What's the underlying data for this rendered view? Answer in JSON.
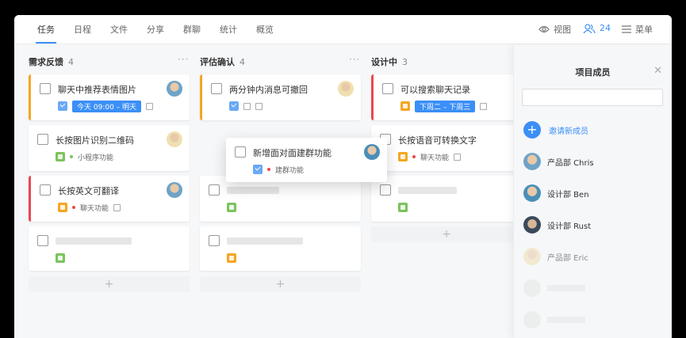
{
  "nav": {
    "tabs": [
      "任务",
      "日程",
      "文件",
      "分享",
      "群聊",
      "统计",
      "概览"
    ],
    "view_label": "视图",
    "member_count": "24",
    "menu_label": "菜单"
  },
  "columns": [
    {
      "title": "需求反馈",
      "count": "4",
      "cards": [
        {
          "title": "聊天中推荐表情图片",
          "date": "今天 09:00 – 明天"
        },
        {
          "title": "长按图片识别二维码",
          "tag": "小程序功能"
        },
        {
          "title": "长按英文可翻译",
          "tag": "聊天功能"
        }
      ]
    },
    {
      "title": "评估确认",
      "count": "4",
      "cards": [
        {
          "title": "两分钟内消息可撤回"
        }
      ]
    },
    {
      "title": "设计中",
      "count": "3",
      "cards": [
        {
          "title": "可以搜索聊天记录",
          "date": "下周二 – 下周三"
        },
        {
          "title": "长按语音可转换文字",
          "tag": "聊天功能"
        }
      ]
    }
  ],
  "dragging_card": {
    "title": "新增面对面建群功能",
    "tag": "建群功能"
  },
  "members_panel": {
    "title": "项目成员",
    "search_placeholder": "",
    "invite_label": "邀请新成员",
    "members": [
      "产品部 Chris",
      "设计部 Ben",
      "设计部 Rust",
      "产品部 Eric"
    ]
  },
  "colors": {
    "accent": "#3b8ff6",
    "urgent": "#e9484e",
    "warning": "#f5a623",
    "success": "#7cc35f"
  }
}
